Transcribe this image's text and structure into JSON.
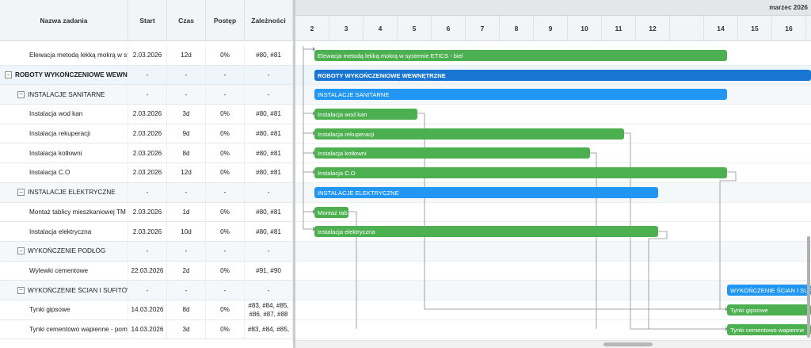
{
  "columns": {
    "name": "Nazwa zadania",
    "start": "Start",
    "duration": "Czas",
    "progress": "Postęp",
    "deps": "Zależności"
  },
  "timeline": {
    "month": "marzec 2026",
    "days": [
      "2",
      "3",
      "4",
      "5",
      "6",
      "7",
      "8",
      "9",
      "10",
      "11",
      "12",
      "14",
      "15",
      "16"
    ]
  },
  "rows": [
    {
      "name": "Elewacja metodą lekką mokrą w systemie ETICS - biel",
      "start": "2.03.2026",
      "duration": "12d",
      "progress": "0%",
      "deps": "#80, #81",
      "deps2": ""
    },
    {
      "name": "ROBOTY WYKOŃCZENIOWE WEWNĘTRZNE",
      "start": "-",
      "duration": "-",
      "progress": "-",
      "deps": "-",
      "deps2": ""
    },
    {
      "name": "INSTALACJE SANITARNE",
      "start": "-",
      "duration": "-",
      "progress": "-",
      "deps": "-",
      "deps2": ""
    },
    {
      "name": "Instalacja wod kan",
      "start": "2.03.2026",
      "duration": "3d",
      "progress": "0%",
      "deps": "#80, #81",
      "deps2": ""
    },
    {
      "name": "Instalacja rekuperacji",
      "start": "2.03.2026",
      "duration": "9d",
      "progress": "0%",
      "deps": "#80, #81",
      "deps2": ""
    },
    {
      "name": "Instalacja kotłowni",
      "start": "2.03.2026",
      "duration": "8d",
      "progress": "0%",
      "deps": "#80, #81",
      "deps2": ""
    },
    {
      "name": "Instalacja C.O",
      "start": "2.03.2026",
      "duration": "12d",
      "progress": "0%",
      "deps": "#80, #81",
      "deps2": ""
    },
    {
      "name": "INSTALACJE ELEKTRYCZNE",
      "start": "-",
      "duration": "-",
      "progress": "-",
      "deps": "-",
      "deps2": ""
    },
    {
      "name": "Montaż tablicy mieszkaniowej TM",
      "start": "2.03.2026",
      "duration": "1d",
      "progress": "0%",
      "deps": "#80, #81",
      "deps2": ""
    },
    {
      "name": "Instalacja elektryczna",
      "start": "2.03.2026",
      "duration": "10d",
      "progress": "0%",
      "deps": "#80, #81",
      "deps2": ""
    },
    {
      "name": "WYKOŃCZENIE PODŁÓG",
      "start": "-",
      "duration": "-",
      "progress": "-",
      "deps": "-",
      "deps2": ""
    },
    {
      "name": "Wylewki cementowe",
      "start": "22.03.2026",
      "duration": "2d",
      "progress": "0%",
      "deps": "#91, #90",
      "deps2": ""
    },
    {
      "name": "WYKOŃCZENIE ŚCIAN I SUFITÓW",
      "start": "-",
      "duration": "-",
      "progress": "-",
      "deps": "-",
      "deps2": ""
    },
    {
      "name": "Tynki gipsowe",
      "start": "14.03.2026",
      "duration": "8d",
      "progress": "0%",
      "deps": "#83, #84, #85,",
      "deps2": "#86, #87, #88"
    },
    {
      "name": "Tynki cementowo wapienne - pom. mokre",
      "start": "14.03.2026",
      "duration": "3d",
      "progress": "0%",
      "deps": "#83, #84, #85,",
      "deps2": ""
    }
  ],
  "bars": [
    {
      "label": "Elewacja metodą lekką mokrą w systemie ETICS - biel"
    },
    {
      "label": "ROBOTY WYKOŃCZENIOWE WEWNĘTRZNE"
    },
    {
      "label": "INSTALACJE SANITARNE"
    },
    {
      "label": "Instalacja wod kan"
    },
    {
      "label": "Instalacja rekuperacji"
    },
    {
      "label": "Instalacja kotłowni"
    },
    {
      "label": "Instalacja C.O"
    },
    {
      "label": "INSTALACJE ELEKTRYCZNE"
    },
    {
      "label": "Montaż tab"
    },
    {
      "label": "Instalacja elektryczna"
    },
    {
      "label": "WYKOŃCZENIE ŚCIAN I SUFITÓW"
    },
    {
      "label": "Tynki gipsowe"
    },
    {
      "label": "Tynki cementowo wapienne"
    }
  ]
}
